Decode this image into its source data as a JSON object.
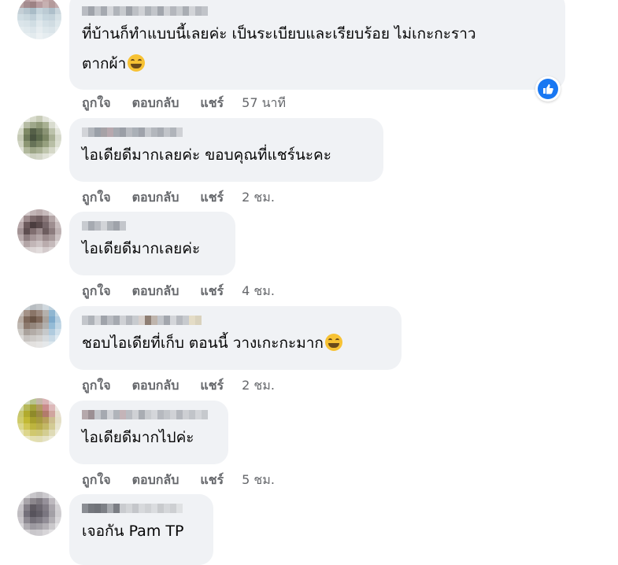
{
  "comments": [
    {
      "text_line1": "ที่บ้านก็ทำแบบนี้เลยค่ะ เป็นระเบียบและเรียบร้อย ไม่เกะกะราว",
      "text_line2": "ตากผ้า",
      "has_emoji": true,
      "reaction": "like",
      "time": "57 นาที"
    },
    {
      "text_line1": "ไอเดียดีมากเลยค่ะ ขอบคุณที่แชร์นะคะ",
      "time": "2 ชม."
    },
    {
      "text_line1": "ไอเดียดีมากเลยค่ะ",
      "time": "4 ชม."
    },
    {
      "text_line1": "ชอบไอเดียที่เก็บ ตอนนี้ วางเกะกะมาก",
      "has_emoji": true,
      "time": "2 ชม."
    },
    {
      "text_line1": "ไอเดียดีมากไปค่ะ",
      "time": "5 ชม."
    },
    {
      "text_line1": "เจอกัน Pam TP"
    }
  ],
  "actions": {
    "like": "ถูกใจ",
    "reply": "ตอบกลับ",
    "share": "แชร์"
  },
  "icons": {
    "reaction": "thumbs-up-icon",
    "emoji": "grinning-squinting-face-icon"
  },
  "colors": {
    "bubble": "#f0f2f5",
    "action_text": "#65676b",
    "like_blue": "#1877f2"
  }
}
